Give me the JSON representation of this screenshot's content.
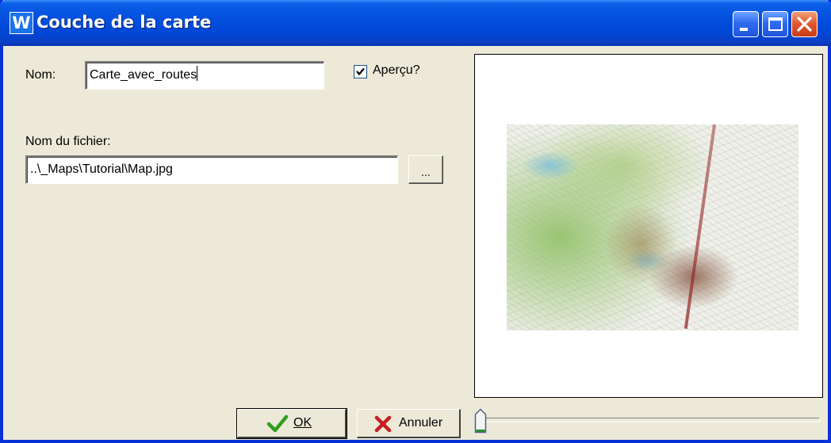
{
  "window": {
    "title": "Couche de la carte",
    "app_icon_letter": "W",
    "controls": [
      "minimize-icon",
      "maximize-icon",
      "close-icon"
    ]
  },
  "form": {
    "name_label": "Nom:",
    "name_value": "Carte_avec_routes",
    "preview_label": "Aperçu?",
    "preview_checked": true,
    "filename_label": "Nom du fichier:",
    "filename_value": "..\\_Maps\\Tutorial\\Map.jpg",
    "browse_label": "..."
  },
  "preview": {
    "image": "topographic-map-thumbnail"
  },
  "buttons": {
    "ok_label": "OK",
    "ok_icon": "checkmark-icon",
    "cancel_label": "Annuler",
    "cancel_icon": "red-x-icon"
  },
  "slider": {
    "value": 0
  },
  "colors": {
    "titlebar": "#0550de",
    "face": "#ece9d8",
    "close_button": "#e0552d",
    "ok_icon": "#2f9e1f",
    "cancel_icon": "#c81e1e"
  }
}
